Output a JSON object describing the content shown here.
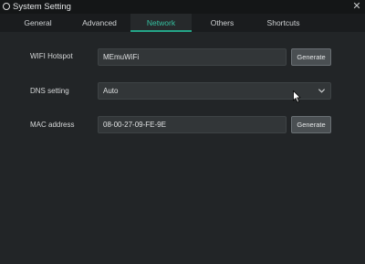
{
  "window": {
    "title": "System Setting",
    "close_glyph": "✕"
  },
  "tabs": [
    {
      "label": "General"
    },
    {
      "label": "Advanced"
    },
    {
      "label": "Network",
      "active": true
    },
    {
      "label": "Others"
    },
    {
      "label": "Shortcuts"
    }
  ],
  "network": {
    "wifi_hotspot": {
      "label": "WIFI Hotspot",
      "value": "MEmuWiFi",
      "button": "Generate"
    },
    "dns_setting": {
      "label": "DNS setting",
      "value": "Auto"
    },
    "mac_address": {
      "label": "MAC address",
      "value": "08-00-27-09-FE-9E",
      "button": "Generate"
    }
  },
  "colors": {
    "accent": "#35c0a0",
    "background": "#222527",
    "titlebar": "#141617"
  }
}
